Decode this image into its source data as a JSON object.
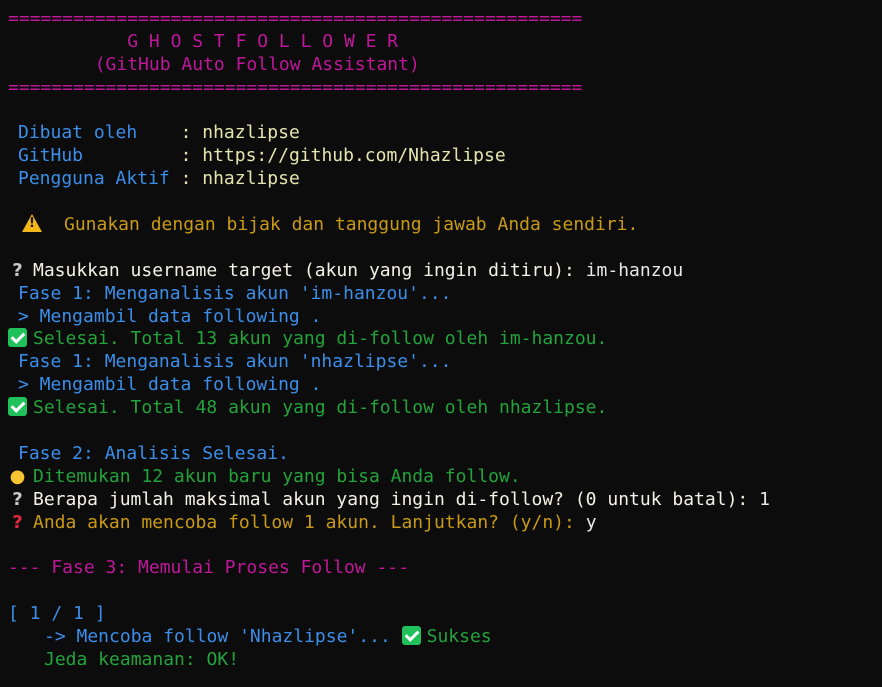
{
  "banner": {
    "rule": "=====================================================",
    "title": "G H O S T F O L L O W E R",
    "subtitle": "(GitHub Auto Follow Assistant)"
  },
  "info": {
    "created_by_label": "Dibuat oleh    ",
    "created_by_value": "nhazlipse",
    "github_label": "GitHub         ",
    "github_value": "https://github.com/Nhazlipse",
    "active_user_label": "Pengguna Aktif ",
    "active_user_value": "nhazlipse",
    "separator": ": "
  },
  "warning": "Gunakan dengan bijak dan tanggung jawab Anda sendiri.",
  "prompt_target": {
    "question": "Masukkan username target (akun yang ingin ditiru): ",
    "answer": "im-hanzou"
  },
  "phase1_a": {
    "title": "Fase 1: Menganalisis akun 'im-hanzou'...",
    "step": "> Mengambil data following .",
    "done": "Selesai. Total 13 akun yang di-follow oleh im-hanzou."
  },
  "phase1_b": {
    "title": "Fase 1: Menganalisis akun 'nhazlipse'...",
    "step": "> Mengambil data following .",
    "done": "Selesai. Total 48 akun yang di-follow oleh nhazlipse."
  },
  "phase2": {
    "title": "Fase 2: Analisis Selesai.",
    "found": "Ditemukan 12 akun baru yang bisa Anda follow.",
    "max_question": "Berapa jumlah maksimal akun yang ingin di-follow? (0 untuk batal): ",
    "max_answer": "1",
    "confirm_question": "Anda akan mencoba follow 1 akun. Lanjutkan? (y/n): ",
    "confirm_answer": "y"
  },
  "phase3": {
    "header": "--- Fase 3: Memulai Proses Follow ---",
    "counter": "[ 1 / 1 ]",
    "attempt": "-> Mencoba follow 'Nhazlipse'... ",
    "result": "Sukses",
    "delay": "Jeda keamanan: OK!"
  },
  "icons": {
    "warning": "warning-triangle-icon",
    "question": "question-mark-icon",
    "check": "check-mark-icon",
    "bulb": "light-bulb-icon",
    "question_red": "red-question-mark-icon"
  },
  "colors": {
    "background": "#0c0c0c",
    "magenta": "#c0179a",
    "blue": "#3b8eea",
    "green": "#23a33b",
    "amber": "#c99a16",
    "label": "#e5e5b0"
  }
}
